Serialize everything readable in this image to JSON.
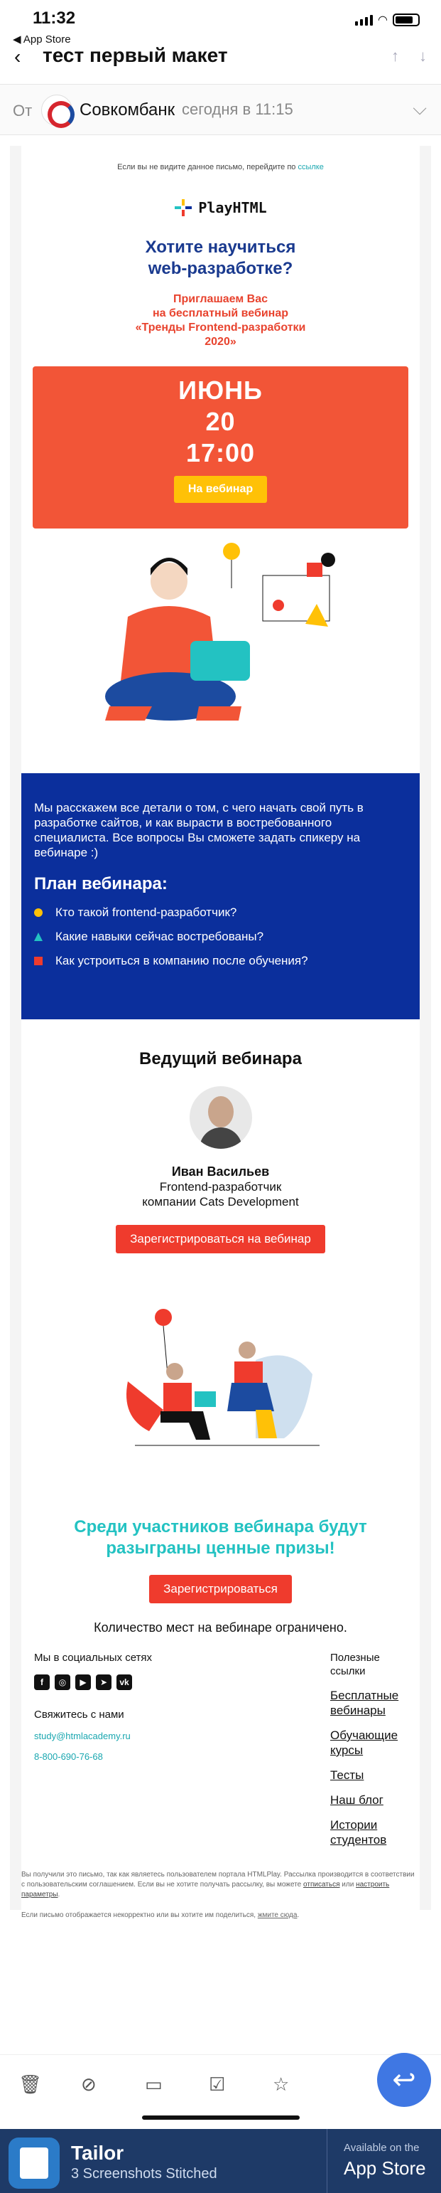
{
  "status": {
    "time": "11:32",
    "back_app": "◀ App Store"
  },
  "nav": {
    "back_icon": "chevron-left-icon",
    "title": "тест первый макет"
  },
  "message": {
    "from_label": "От",
    "sender": "Совкомбанк",
    "date": "сегодня в 11:15"
  },
  "email": {
    "preheader_text": "Если вы не видите данное письмо, перейдите по",
    "preheader_link": "ссылке",
    "brand": "PlayHTML",
    "headline_1": "Хотите научиться",
    "headline_2": "web-разработке?",
    "invite_1": "Приглашаем Вас",
    "invite_2": "на бесплатный вебинар",
    "invite_3": "«Тренды Frontend-разработки",
    "invite_4": "2020»",
    "hero_month": "ИЮНЬ",
    "hero_day": "20",
    "hero_time": "17:00",
    "hero_button": "На вебинар",
    "intro": "Мы расскажем все детали о том, с чего начать свой путь в разработке сайтов, и как вырасти в востребованного специалиста. Все вопросы Вы сможете задать спикеру на вебинаре :)",
    "plan_title": "План вебинара:",
    "plan_items": [
      {
        "text": "Кто такой frontend-разработчик?",
        "color": "#ffc107"
      },
      {
        "text": "Какие навыки сейчас востребованы?",
        "color": "#23c2c2"
      },
      {
        "text": "Как устроиться в компанию после обучения?",
        "color": "#ef3b2d"
      }
    ],
    "host_title": "Ведущий вебинара",
    "host_name": "Иван Васильев",
    "host_role_1": "Frontend-разработчик",
    "host_role_2": "компании Cats Development",
    "register_button": "Зарегистрироваться на вебинар",
    "prize_1": "Среди участников вебинара будут",
    "prize_2": "разыграны ценные призы!",
    "register_button_2": "Зарегистрироваться",
    "limited": "Количество мест на вебинаре ограничено.",
    "social_title": "Мы в социальных сетях",
    "social_icons": [
      "facebook-icon",
      "instagram-icon",
      "youtube-icon",
      "telegram-icon",
      "vk-icon"
    ],
    "contacts_title": "Свяжитесь с нами",
    "contact_email": "study@htmlacademy.ru",
    "contact_phone": "8-800-690-76-68",
    "links_title": "Полезные ссылки",
    "links": [
      "Бесплатные вебинары",
      "Обучающие курсы",
      "Тесты",
      "Наш блог",
      "Истории студентов"
    ],
    "legal_1": "Вы получили это письмо, так как являетесь пользователем портала HTMLPlay. Рассылка производится в соответствии с пользовательским соглашением. Если вы не хотите получать рассылку, вы можете",
    "legal_unsub": "отписаться",
    "legal_or": "или",
    "legal_settings": "настроить параметры",
    "legal_2": "Если письмо отображается некорректно или вы хотите им поделиться,",
    "legal_2_link": "жмите сюда"
  },
  "toolbar": {
    "icons": [
      "trash-icon",
      "spam-icon",
      "folder-icon",
      "mark-icon",
      "star-icon"
    ],
    "reply_icon": "reply-icon"
  },
  "banner": {
    "app": "Tailor",
    "subtitle": "3 Screenshots Stitched",
    "store_small": "Available on the",
    "store_big": "App Store"
  }
}
